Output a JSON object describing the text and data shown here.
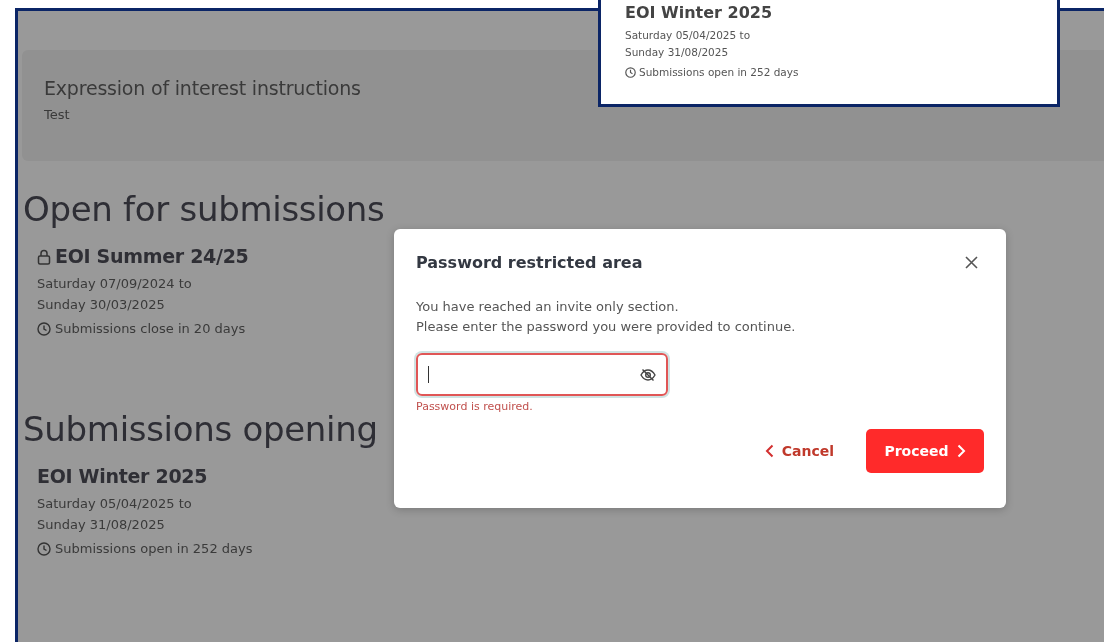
{
  "instructions": {
    "title": "Expression of interest instructions",
    "text": "Test"
  },
  "sections": [
    {
      "heading": "Open for submissions",
      "items": [
        {
          "title": "EOI Summer 24/25",
          "locked": true,
          "start": "Saturday 07/09/2024 to",
          "end": "Sunday 30/03/2025",
          "status": "Submissions close in 20 days"
        }
      ]
    },
    {
      "heading": "Submissions opening",
      "items": [
        {
          "title": "EOI Winter 2025",
          "locked": false,
          "start": "Saturday 05/04/2025 to",
          "end": "Sunday 31/08/2025",
          "status": "Submissions open in 252 days"
        }
      ]
    }
  ],
  "callout": {
    "title": "EOI Winter 2025",
    "start": "Saturday 05/04/2025 to",
    "end": "Sunday 31/08/2025",
    "status": "Submissions open in 252 days"
  },
  "dialog": {
    "title": "Password restricted area",
    "message_1": "You have reached an invite only section.",
    "message_2": "Please enter the password you were provided to continue.",
    "error": "Password is required.",
    "cancel": "Cancel",
    "proceed": "Proceed"
  }
}
